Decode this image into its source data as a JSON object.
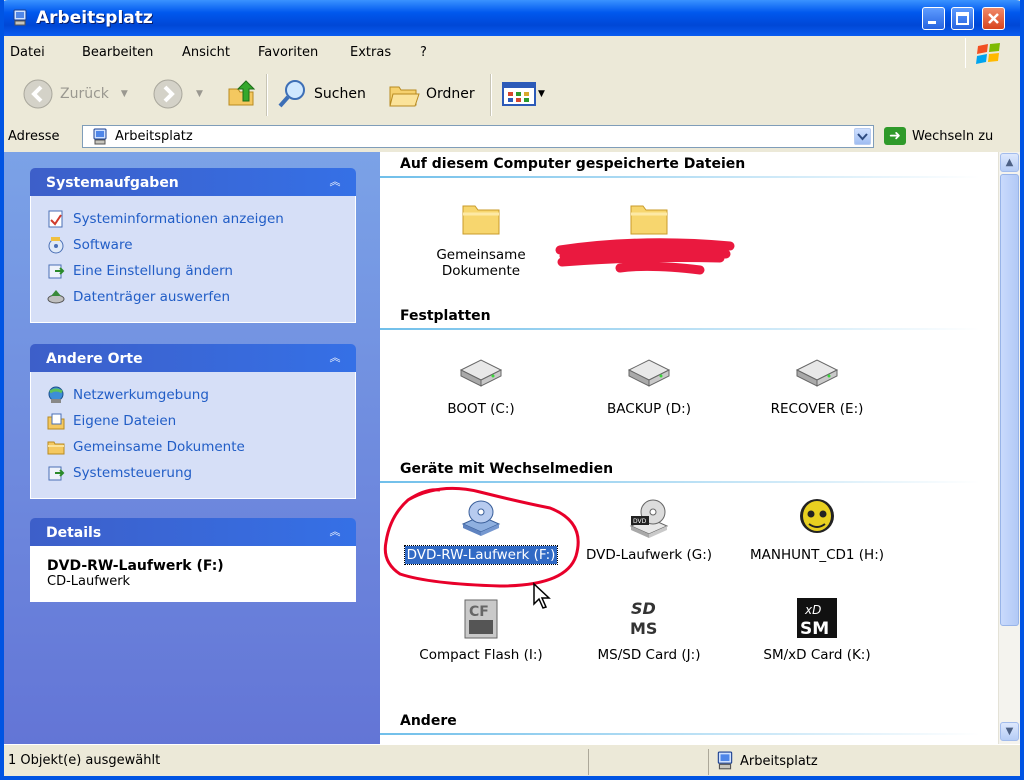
{
  "window": {
    "title": "Arbeitsplatz"
  },
  "menu": [
    "Datei",
    "Bearbeiten",
    "Ansicht",
    "Favoriten",
    "Extras",
    "?"
  ],
  "toolbar": {
    "back_label": "Zurück",
    "search_label": "Suchen",
    "folders_label": "Ordner"
  },
  "address": {
    "label": "Adresse",
    "value": "Arbeitsplatz",
    "go_label": "Wechseln zu"
  },
  "sidebar": {
    "system_tasks": {
      "title": "Systemaufgaben",
      "items": [
        "Systeminformationen anzeigen",
        "Software",
        "Eine Einstellung ändern",
        "Datenträger auswerfen"
      ]
    },
    "other_places": {
      "title": "Andere Orte",
      "items": [
        "Netzwerkumgebung",
        "Eigene Dateien",
        "Gemeinsame Dokumente",
        "Systemsteuerung"
      ]
    },
    "details": {
      "title": "Details",
      "name": "DVD-RW-Laufwerk (F:)",
      "type": "CD-Laufwerk"
    }
  },
  "content": {
    "groups": {
      "files": "Auf diesem Computer gespeicherte Dateien",
      "hard_disks": "Festplatten",
      "removable": "Geräte mit Wechselmedien",
      "other": "Andere"
    },
    "files": [
      "Gemeinsame Dokumente"
    ],
    "hard_disks": [
      "BOOT (C:)",
      "BACKUP (D:)",
      "RECOVER (E:)"
    ],
    "removable": [
      "DVD-RW-Laufwerk (F:)",
      "DVD-Laufwerk (G:)",
      "MANHUNT_CD1 (H:)",
      "Compact Flash (I:)",
      "MS/SD Card (J:)",
      "SM/xD Card (K:)"
    ]
  },
  "status": {
    "left": "1 Objekt(e) ausgewählt",
    "right": "Arbeitsplatz"
  },
  "colors": {
    "titlebar": "#0058ee",
    "sidebar": "#6f8fe0",
    "selection": "#316ac5",
    "annotation": "#e8002a"
  }
}
